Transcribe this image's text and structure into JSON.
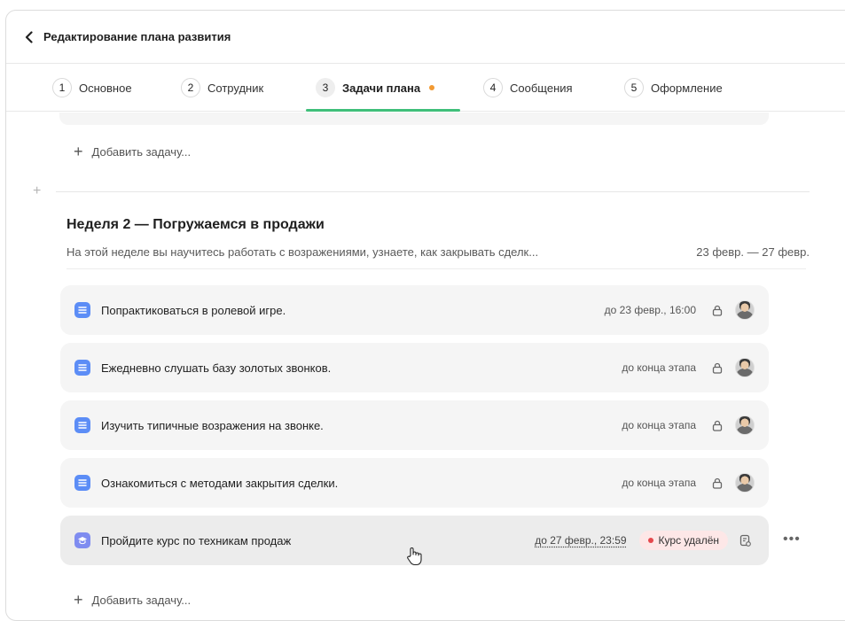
{
  "header": {
    "title": "Редактирование плана развития"
  },
  "tabs": [
    {
      "num": "1",
      "label": "Основное"
    },
    {
      "num": "2",
      "label": "Сотрудник"
    },
    {
      "num": "3",
      "label": "Задачи плана"
    },
    {
      "num": "4",
      "label": "Сообщения"
    },
    {
      "num": "5",
      "label": "Оформление"
    }
  ],
  "active_tab": "3",
  "add_task_label": "Добавить задачу...",
  "week": {
    "title": "Неделя 2 — Погружаемся в продажи",
    "description": "На этой неделе вы научитесь работать с возражениями, узнаете, как закрывать сделк...",
    "dates": "23 февр. — 27 февр."
  },
  "tasks": [
    {
      "name": "Попрактиковаться в ролевой игре.",
      "due": "до 23 февр., 16:00",
      "icon": "list-icon"
    },
    {
      "name": "Ежедневно слушать базу золотых звонков.",
      "due": "до конца этапа",
      "icon": "list-icon"
    },
    {
      "name": "Изучить типичные возражения на звонке.",
      "due": "до конца этапа",
      "icon": "list-icon"
    },
    {
      "name": "Ознакомиться с методами закрытия сделки.",
      "due": "до конца этапа",
      "icon": "list-icon"
    },
    {
      "name": "Пройдите курс по техникам продаж",
      "due": "до 27 февр., 23:59",
      "icon": "course-icon",
      "badge": "Курс удалён"
    }
  ],
  "colors": {
    "accent_green": "#3fbf7a",
    "orange_dot": "#f29a32",
    "task_icon_blue": "#5c8df6",
    "badge_bg": "#fde7e7",
    "badge_dot": "#e5484d"
  }
}
